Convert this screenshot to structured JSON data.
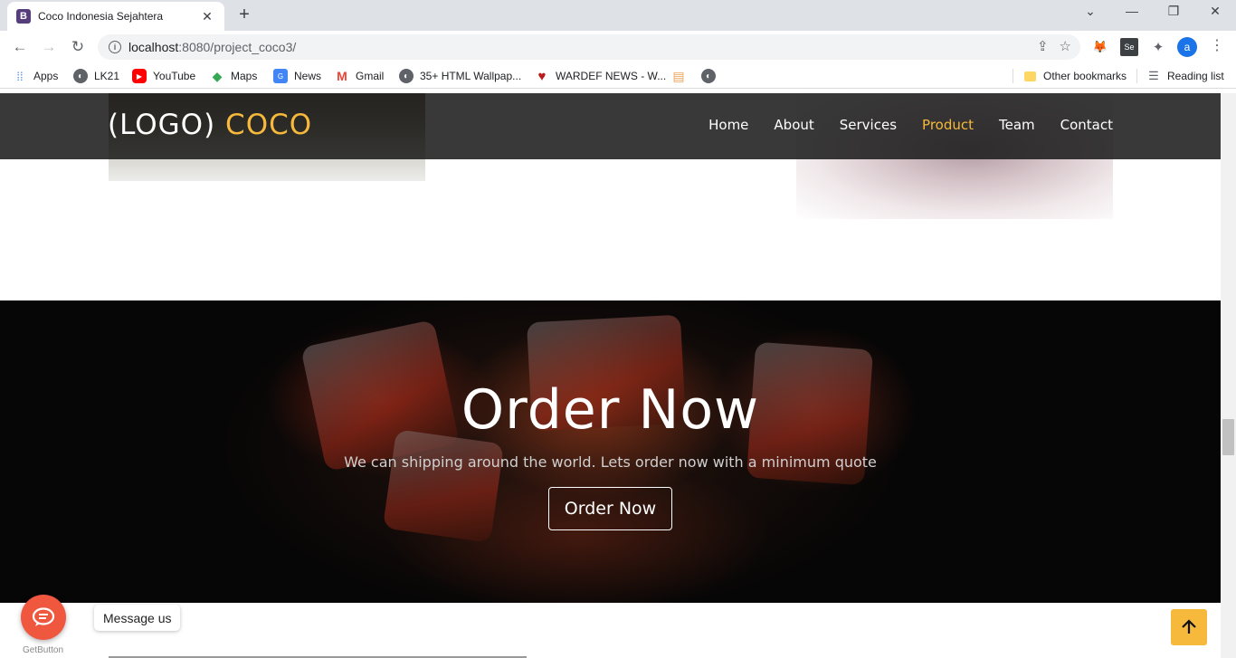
{
  "browser": {
    "tab_title": "Coco Indonesia Sejahtera",
    "tab_favicon_letter": "B",
    "url_host": "localhost",
    "url_rest": ":8080/project_coco3/",
    "avatar_letter": "a",
    "bookmarks": [
      {
        "label": "Apps",
        "icon": "apps-grid-icon"
      },
      {
        "label": "LK21",
        "icon": "globe-icon"
      },
      {
        "label": "YouTube",
        "icon": "youtube-icon"
      },
      {
        "label": "Maps",
        "icon": "maps-icon"
      },
      {
        "label": "News",
        "icon": "news-icon"
      },
      {
        "label": "Gmail",
        "icon": "gmail-icon"
      },
      {
        "label": "35+ HTML Wallpap...",
        "icon": "globe-icon"
      },
      {
        "label": "WARDEF NEWS - W...",
        "icon": "wardef-icon"
      }
    ],
    "other_bookmarks": "Other bookmarks",
    "reading_list": "Reading list"
  },
  "site": {
    "logo_main": "(LOGO)",
    "logo_accent": "COCO",
    "nav": [
      "Home",
      "About",
      "Services",
      "Product",
      "Team",
      "Contact"
    ],
    "active_nav": "Product",
    "accent_color": "#f6b93b"
  },
  "order": {
    "title": "Order Now",
    "subtitle": "We can shipping around the world. Lets order now with a minimum quote",
    "button": "Order Now"
  },
  "widgets": {
    "message_tip": "Message us",
    "getbutton_label": "GetButton"
  }
}
